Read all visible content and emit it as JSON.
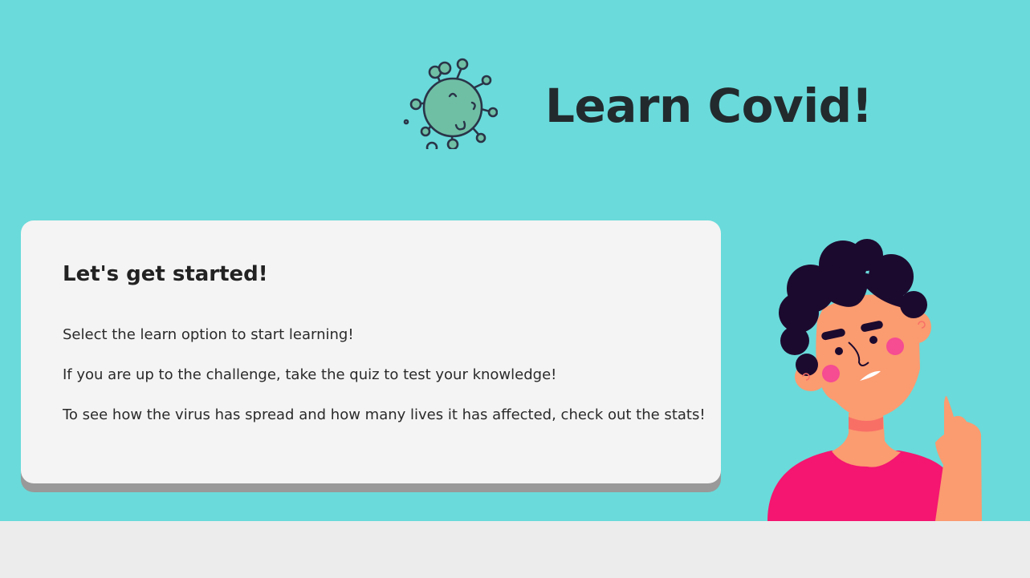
{
  "header": {
    "title": "Learn Covid!",
    "logo_icon": "virus-icon"
  },
  "card": {
    "heading": "Let's get started!",
    "paragraphs": [
      "Select the learn option to start learning!",
      "If you are up to the challenge, take the quiz to test your knowledge!",
      "To see how the virus has spread and how many lives it has affected, check out the stats!"
    ]
  },
  "colors": {
    "background": "#6adada",
    "card": "#f4f4f4",
    "footer": "#ececec",
    "virus": "#6fbfa5",
    "shirt": "#f41670",
    "skin": "#fb9b70",
    "hair": "#1c0a2e"
  }
}
